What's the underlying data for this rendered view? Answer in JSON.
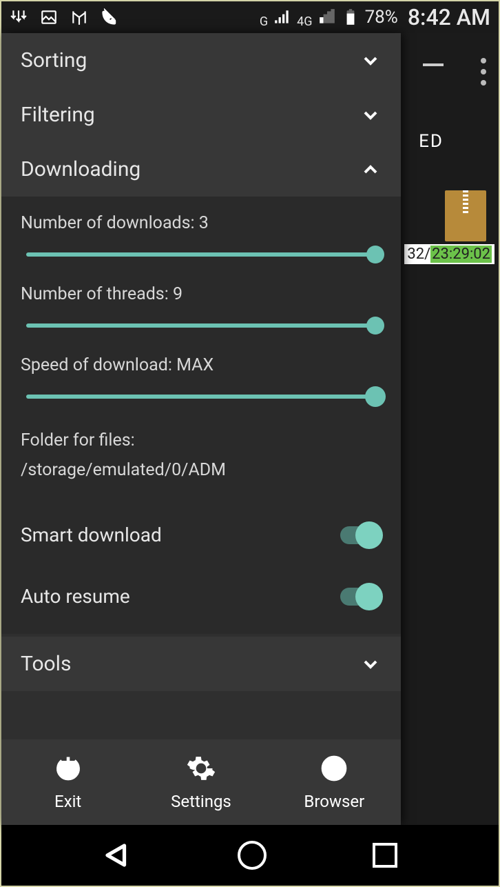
{
  "status": {
    "battery_pct": "78%",
    "time": "8:42 AM",
    "net_g": "G",
    "net_4g": "4G"
  },
  "background": {
    "ed_text": "ED",
    "timestamp_prefix": "32/",
    "timestamp_suffix": "23:29:02"
  },
  "drawer": {
    "sections": {
      "sorting": "Sorting",
      "filtering": "Filtering",
      "downloading": "Downloading",
      "tools": "Tools"
    },
    "sliders": {
      "num_downloads": {
        "label": "Number of downloads: 3"
      },
      "num_threads": {
        "label": "Number of threads: 9"
      },
      "speed": {
        "label": "Speed of download: MAX"
      }
    },
    "folder": {
      "label": "Folder for files:",
      "path": "/storage/emulated/0/ADM"
    },
    "toggles": {
      "smart_download": "Smart download",
      "auto_resume": "Auto resume"
    }
  },
  "actions": {
    "exit": "Exit",
    "settings": "Settings",
    "browser": "Browser"
  }
}
